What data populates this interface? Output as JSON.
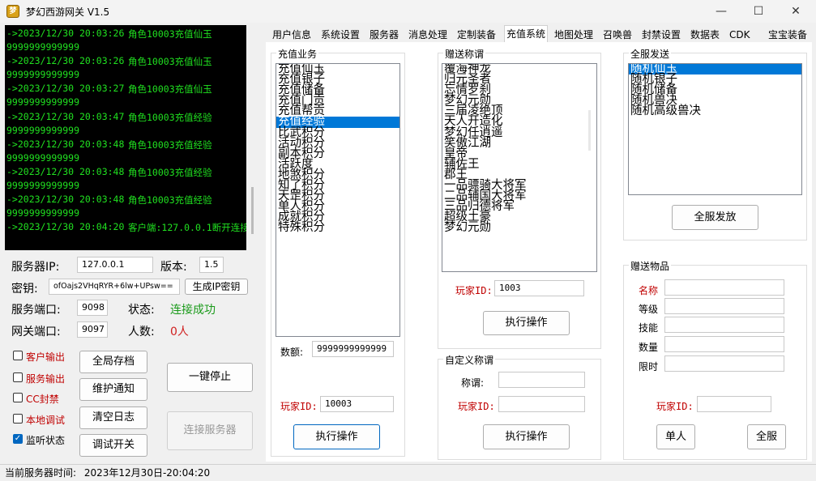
{
  "window": {
    "title": "梦幻西游网关 V1.5",
    "icon_text": "梦",
    "minimize": "—",
    "maximize": "☐",
    "close": "✕"
  },
  "log": [
    {
      "time": "->2023/12/30 20:03:26",
      "msg": "角色10003充值仙玉",
      "cont": "9999999999999"
    },
    {
      "time": "->2023/12/30 20:03:26",
      "msg": "角色10003充值仙玉",
      "cont": "9999999999999"
    },
    {
      "time": "->2023/12/30 20:03:27",
      "msg": "角色10003充值仙玉",
      "cont": "9999999999999"
    },
    {
      "time": "->2023/12/30 20:03:47",
      "msg": "角色10003充值经验",
      "cont": "9999999999999"
    },
    {
      "time": "->2023/12/30 20:03:48",
      "msg": "角色10003充值经验",
      "cont": "9999999999999"
    },
    {
      "time": "->2023/12/30 20:03:48",
      "msg": "角色10003充值经验",
      "cont": "9999999999999"
    },
    {
      "time": "->2023/12/30 20:03:48",
      "msg": "角色10003充值经验",
      "cont": "9999999999999"
    },
    {
      "time": "->2023/12/30 20:04:20",
      "msg": "客户端:127.0.0.1断开连接",
      "cont": ""
    }
  ],
  "server": {
    "ip_label": "服务器IP:",
    "ip_value": "127.0.0.1",
    "version_label": "版本:",
    "version_value": "1.5",
    "key_label": "密钥:",
    "key_value": "ofOajs2VHqRYR+6lw+UPsw==",
    "gen_key_button": "生成IP密钥",
    "port_label": "服务端口:",
    "port_value": "9098",
    "status_label": "状态:",
    "status_value": "连接成功",
    "gate_port_label": "网关端口:",
    "gate_port_value": "9097",
    "count_label": "人数:",
    "count_value": "0人"
  },
  "checkboxes": [
    {
      "label": "客户输出",
      "checked": false
    },
    {
      "label": "服务输出",
      "checked": false
    },
    {
      "label": "CC封禁",
      "checked": false
    },
    {
      "label": "本地调试",
      "checked": false
    },
    {
      "label": "监听状态",
      "checked": true
    }
  ],
  "checkmark": "✓",
  "buttons": {
    "save_all": "全局存档",
    "maintenance": "维护通知",
    "clear_log": "清空日志",
    "debug": "调试开关",
    "stop": "一键停止",
    "connect": "连接服务器"
  },
  "tabs": [
    "用户信息",
    "系统设置",
    "服务器",
    "消息处理",
    "定制装备",
    "充值系统",
    "地图处理",
    "召唤兽",
    "封禁设置",
    "数据表",
    "CDK",
    "宝宝装备"
  ],
  "active_tab": "充值系统",
  "recharge": {
    "group_label": "充值业务",
    "items": [
      "充值仙玉",
      "充值银子",
      "充值储备",
      "充值门贡",
      "充值帮贡",
      "充值经验",
      "比武积分",
      "活动积分",
      "副本积分",
      "活跃度",
      "地煞积分",
      "知了积分",
      "天罡积分",
      "单人积分",
      "成就积分",
      "特殊积分"
    ],
    "selected": "充值经验",
    "amount_label": "数额:",
    "amount_value": "9999999999999",
    "player_label": "玩家ID:",
    "player_value": "10003",
    "execute": "执行操作"
  },
  "title_gift": {
    "group_label": "赠送称谓",
    "items": [
      "覆海神龙",
      "归元圣者",
      "忘情罗刹",
      "梦幻元勋",
      "三届凌绝顶",
      "天人开造化",
      "梦幻任逍遥",
      "笑傲江湖",
      "皇帝",
      "辅佐王",
      "郡王",
      "一品骠骑大将军",
      "二品辅国大将军",
      "三品归德将军",
      "超级土豪",
      "梦幻元勋"
    ],
    "player_label": "玩家ID:",
    "player_value": "1003",
    "execute": "执行操作"
  },
  "custom_title": {
    "group_label": "自定义称谓",
    "title_label": "称谓:",
    "title_value": "",
    "player_label": "玩家ID:",
    "player_value": "",
    "execute": "执行操作"
  },
  "broadcast": {
    "group_label": "全服发送",
    "items": [
      "随机仙玉",
      "随机银子",
      "随机储备",
      "随机兽决",
      "随机高级兽决"
    ],
    "selected": "随机仙玉",
    "button": "全服发放"
  },
  "gift_item": {
    "group_label": "赠送物品",
    "name_label": "名称",
    "level_label": "等级",
    "skill_label": "技能",
    "qty_label": "数量",
    "limit_label": "限时",
    "player_label": "玩家ID:",
    "player_value": "",
    "single": "单人",
    "all": "全服"
  },
  "statusbar": {
    "label": "当前服务器时间:",
    "value": "2023年12月30日-20:04:20"
  }
}
